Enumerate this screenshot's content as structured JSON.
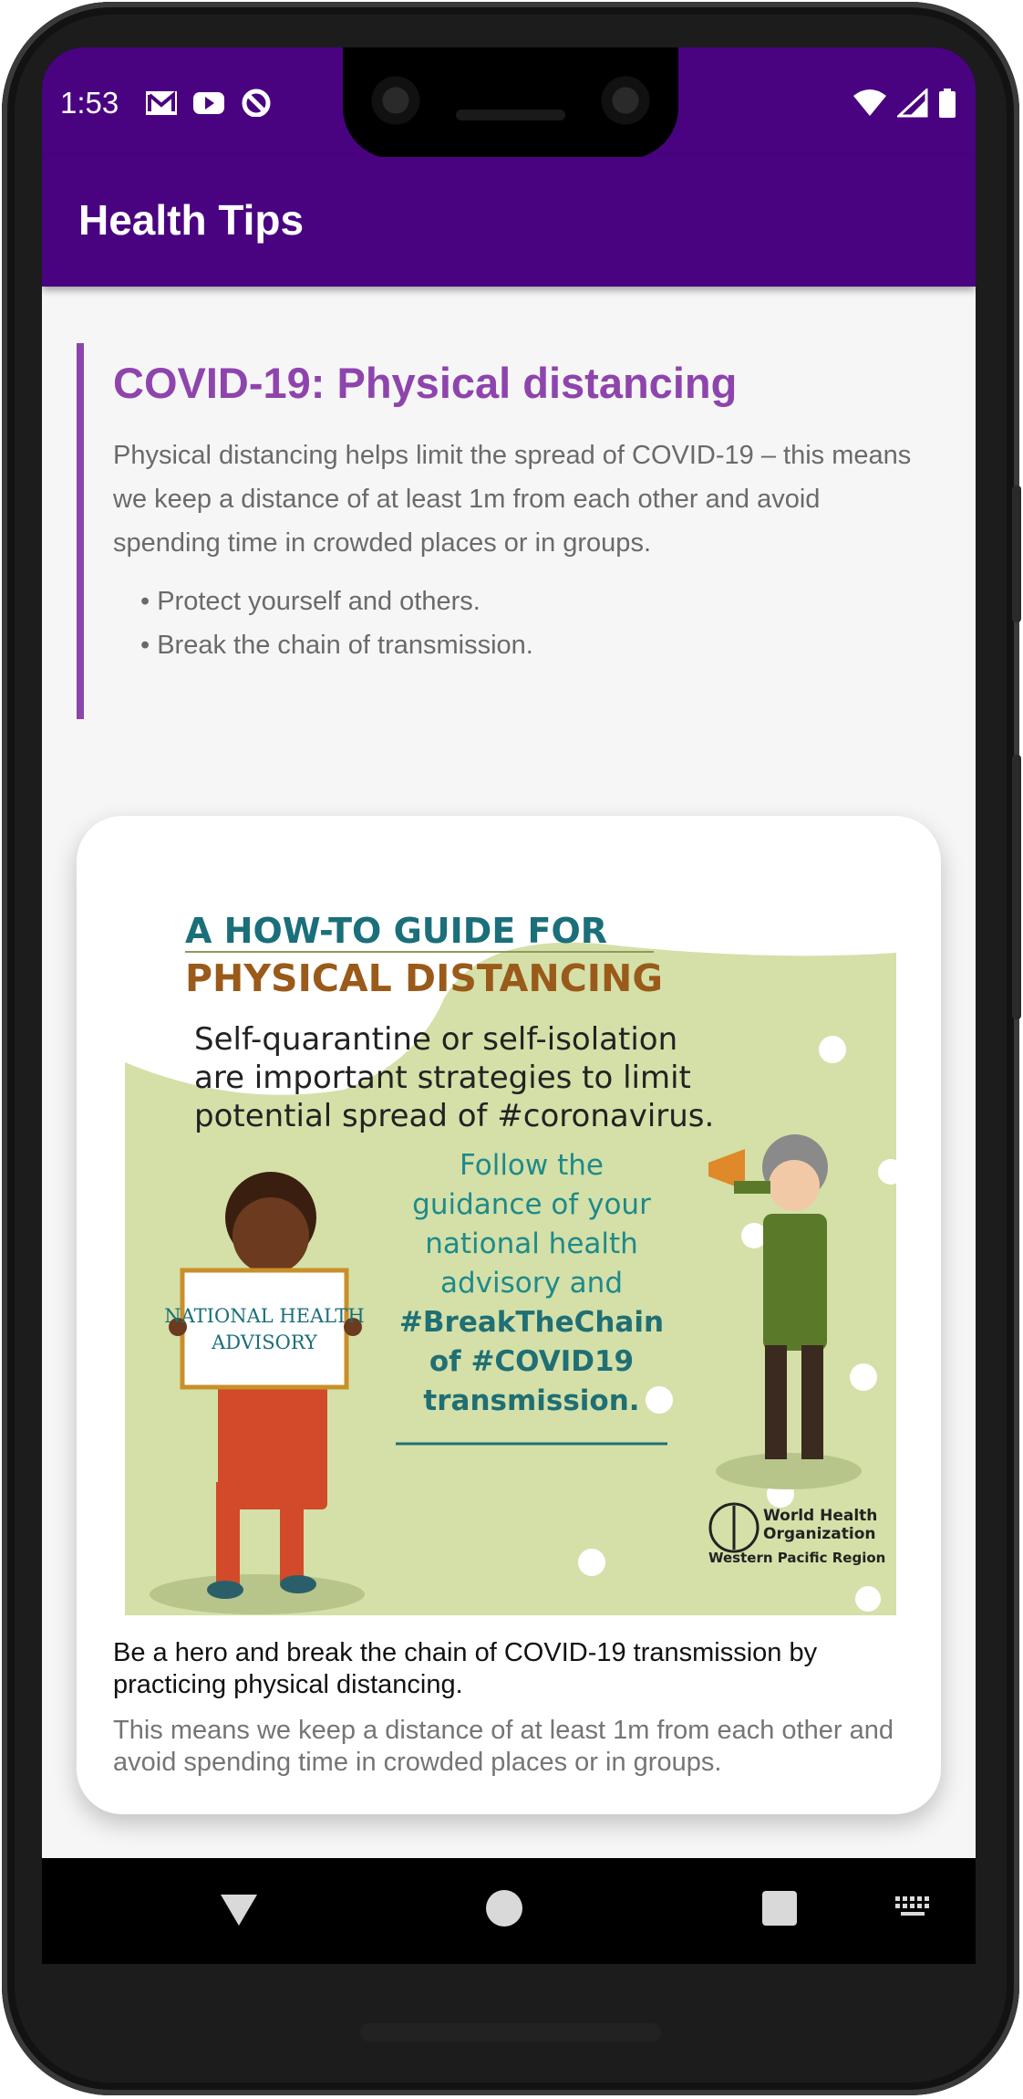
{
  "status_bar": {
    "time": "1:53",
    "left_icons": [
      "gmail-icon",
      "youtube-icon",
      "do-not-disturb-icon"
    ],
    "right_icons": [
      "wifi-icon",
      "cell-signal-icon",
      "battery-icon"
    ]
  },
  "app_bar": {
    "title": "Health Tips",
    "color": "#4a0380"
  },
  "article": {
    "title": "COVID-19: Physical distancing",
    "body": "Physical distancing helps limit the spread of COVID-19 – this means we keep a distance of at least 1m from each other and avoid spending time in crowded places or in groups.",
    "bullets": [
      "• Protect yourself and others.",
      "• Break the chain of transmission."
    ],
    "accent_color": "#8e44ad"
  },
  "card": {
    "poster": {
      "heading_line1": "A HOW-TO GUIDE FOR",
      "heading_line2": "PHYSICAL DISTANCING",
      "intro_lines": [
        "Self-quarantine or self-isolation",
        "are important strategies to limit",
        "potential spread of #coronavirus."
      ],
      "guidance_lines": [
        "Follow the",
        "guidance of your",
        "national health",
        "advisory and"
      ],
      "hashtag_lines": [
        "#BreakTheChain",
        "of #COVID19",
        "transmission."
      ],
      "sign_lines": [
        "NATIONAL HEALTH",
        "ADVISORY"
      ],
      "org_lines": [
        "World Health",
        "Organization",
        "Western Pacific Region"
      ]
    },
    "caption": "Be a hero and break the chain of COVID-19 transmission by practicing physical distancing.",
    "subcaption": "This means we keep a distance of at least 1m from each other and avoid spending time in crowded places or in groups."
  },
  "nav_bar": {
    "buttons": [
      "back-icon",
      "home-icon",
      "recents-icon",
      "keyboard-icon"
    ]
  }
}
